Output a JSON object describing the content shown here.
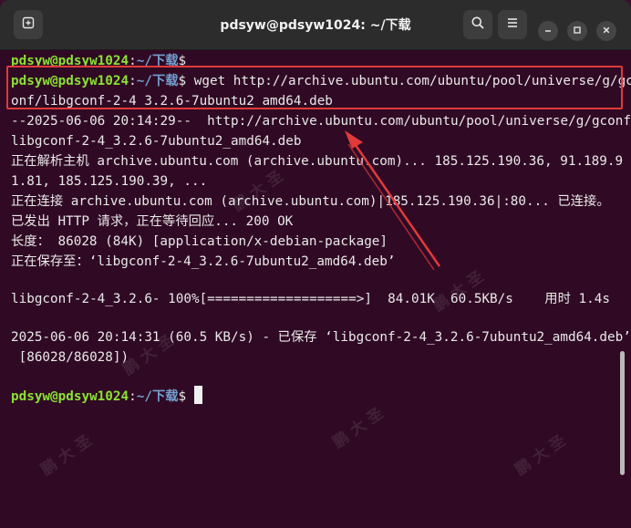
{
  "window": {
    "title": "pdsyw@pdsyw1024: ~/下载"
  },
  "icons": {
    "new_tab": "new-tab-icon",
    "search": "search-icon",
    "menu": "hamburger-menu-icon",
    "minimize": "minimize-icon",
    "maximize": "maximize-icon",
    "close": "close-icon"
  },
  "colors": {
    "terminal_bg": "#300a24",
    "prompt_user": "#8ae234",
    "prompt_path": "#729fcf",
    "highlight_box": "#e03a3a",
    "arrow": "#e03a3a"
  },
  "terminal": {
    "prompt_user": "pdsyw@pdsyw1024",
    "prompt_sep": ":",
    "prompt_path": "~/下载",
    "prompt_dollar": "$",
    "command_line1": " wget http://archive.ubuntu.com/ubuntu/pool/universe/g/gc",
    "command_line2": "onf/libgconf-2-4_3.2.6-7ubuntu2_amd64.deb",
    "output": [
      "--2025-06-06 20:14:29--  http://archive.ubuntu.com/ubuntu/pool/universe/g/gconf/",
      "libgconf-2-4_3.2.6-7ubuntu2_amd64.deb",
      "正在解析主机 archive.ubuntu.com (archive.ubuntu.com)... 185.125.190.36, 91.189.9",
      "1.81, 185.125.190.39, ...",
      "正在连接 archive.ubuntu.com (archive.ubuntu.com)|185.125.190.36|:80... 已连接。",
      "已发出 HTTP 请求，正在等待回应... 200 OK",
      "长度： 86028 (84K) [application/x-debian-package]",
      "正在保存至：‘libgconf-2-4_3.2.6-7ubuntu2_amd64.deb’",
      "libgconf-2-4_3.2.6- 100%[===================>]  84.01K  60.5KB/s    用时 1.4s",
      "2025-06-06 20:14:31 (60.5 KB/s) - 已保存 ‘libgconf-2-4_3.2.6-7ubuntu2_amd64.deb’",
      " [86028/86028])"
    ]
  },
  "watermark_text": "鹏 大 圣"
}
